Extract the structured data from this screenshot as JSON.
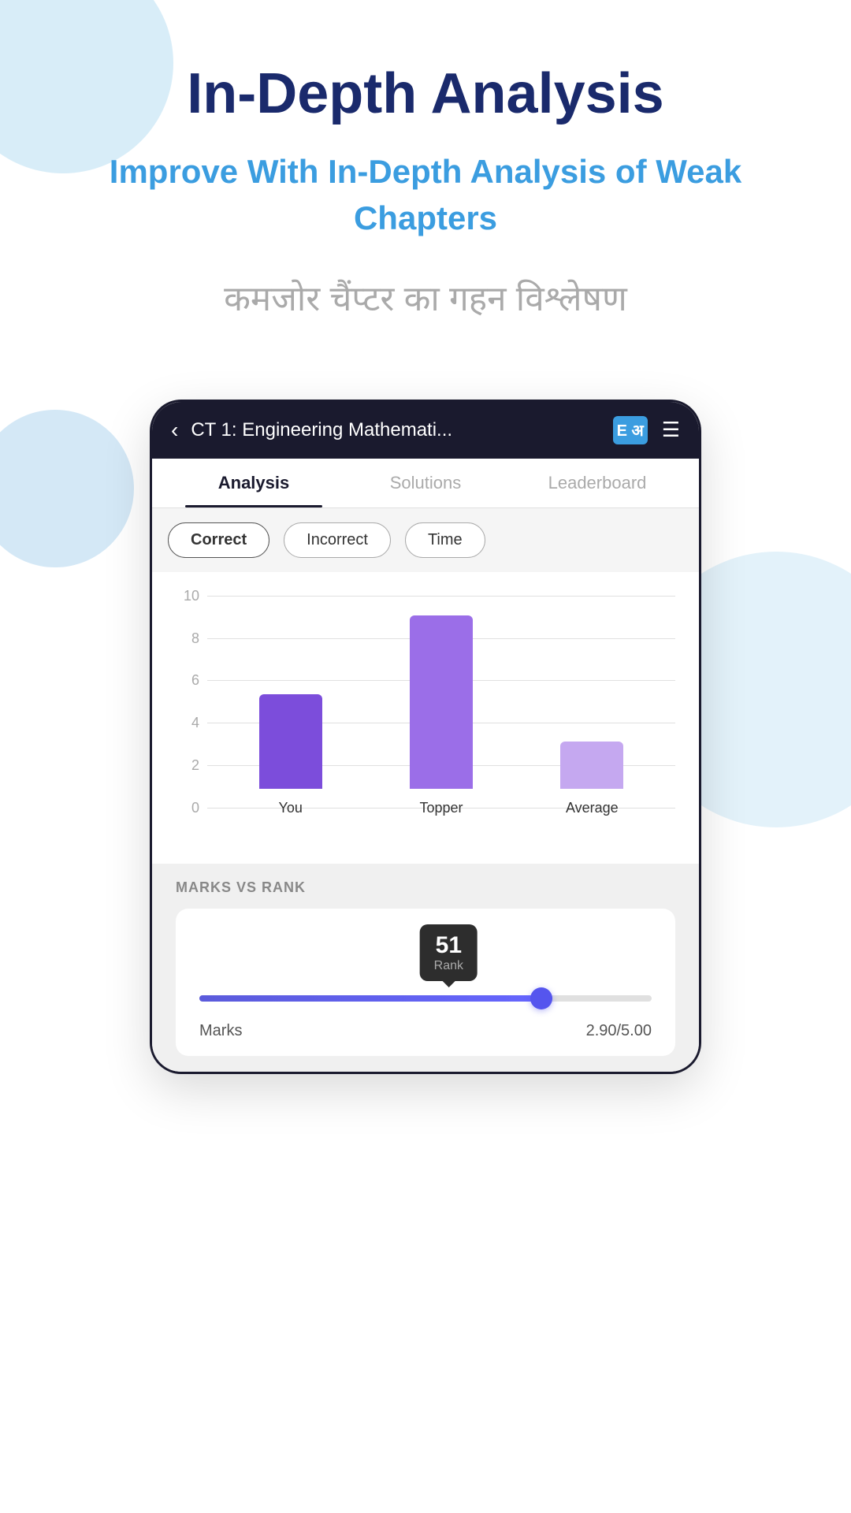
{
  "page": {
    "title": "In-Depth Analysis",
    "subtitle": "Improve With In-Depth Analysis of Weak Chapters",
    "hindi_subtitle": "कमजोर चैंप्टर का गहन विश्लेषण"
  },
  "topbar": {
    "title": "CT 1: Engineering Mathemati...",
    "back_label": "‹",
    "menu_label": "☰",
    "book_label": "E अ"
  },
  "tabs": [
    {
      "id": "analysis",
      "label": "Analysis",
      "active": true
    },
    {
      "id": "solutions",
      "label": "Solutions",
      "active": false
    },
    {
      "id": "leaderboard",
      "label": "Leaderboard",
      "active": false
    }
  ],
  "filter_chips": [
    {
      "id": "correct",
      "label": "Correct",
      "selected": true
    },
    {
      "id": "incorrect",
      "label": "Incorrect",
      "selected": false
    },
    {
      "id": "time",
      "label": "Time",
      "selected": false
    }
  ],
  "chart": {
    "y_labels": [
      "10",
      "8",
      "6",
      "4",
      "2",
      "0"
    ],
    "bars": [
      {
        "id": "you",
        "label": "You",
        "height_pct": 45
      },
      {
        "id": "topper",
        "label": "Topper",
        "height_pct": 82
      },
      {
        "id": "average",
        "label": "Average",
        "height_pct": 22
      }
    ]
  },
  "marks_vs_rank": {
    "section_title": "MARKS VS RANK",
    "rank_number": "51",
    "rank_label": "Rank",
    "marks_label": "Marks",
    "marks_value": "2.90/5.00",
    "slider_fill_pct": 78
  }
}
